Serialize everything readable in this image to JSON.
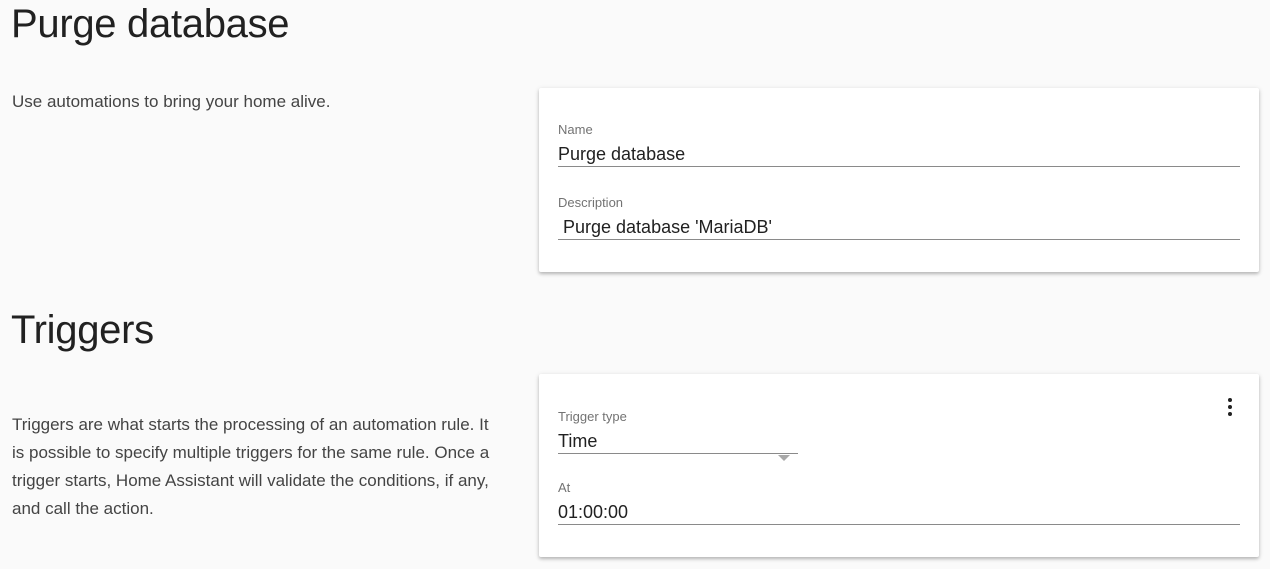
{
  "automation": {
    "title": "Purge database",
    "intro": "Use automations to bring your home alive.",
    "name_label": "Name",
    "name_value": "Purge database",
    "description_label": "Description",
    "description_value": " Purge database 'MariaDB'"
  },
  "triggers": {
    "title": "Triggers",
    "intro": "Triggers are what starts the processing of an automation rule. It is possible to specify multiple triggers for the same rule. Once a trigger starts, Home Assistant will validate the conditions, if any, and call the action.",
    "type_label": "Trigger type",
    "type_value": "Time",
    "at_label": "At",
    "at_value": "01:00:00",
    "menu_icon": "more-vert-icon"
  }
}
